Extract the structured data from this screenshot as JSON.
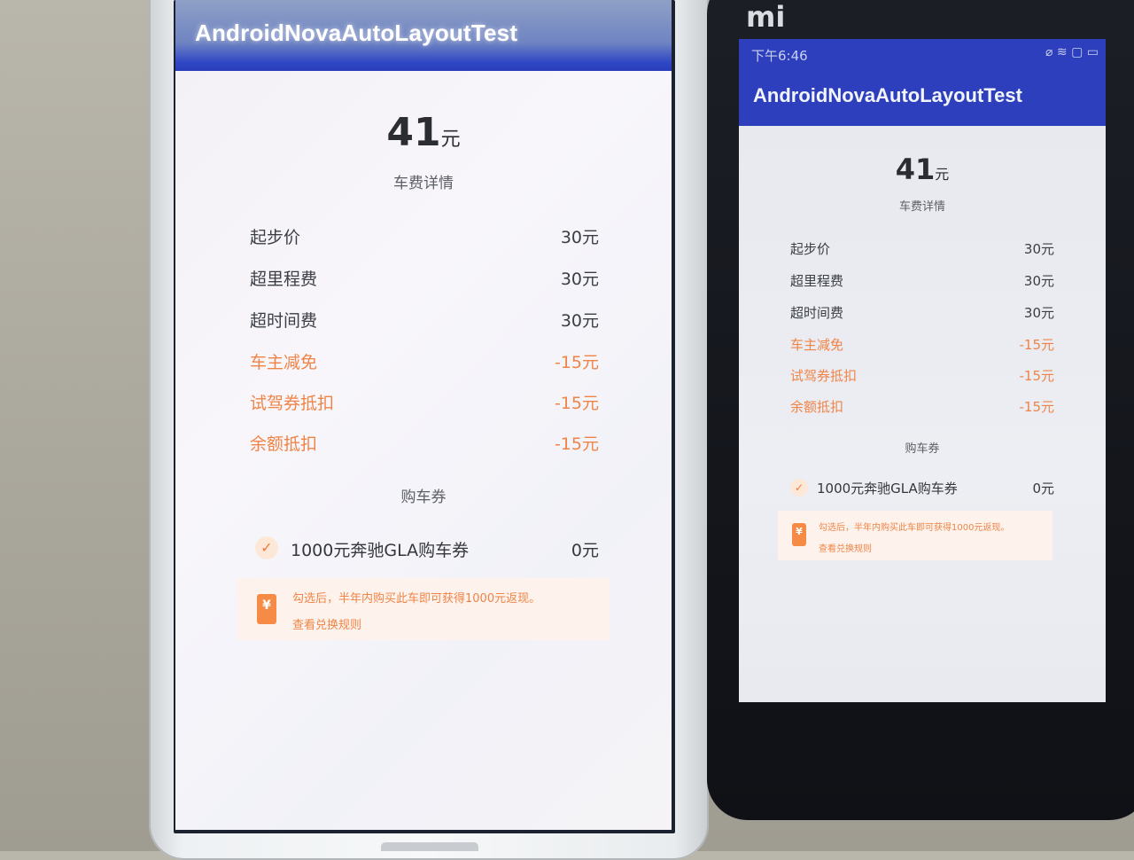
{
  "left_phone": {
    "app_title": "AndroidNovaAutoLayoutTest",
    "total_amount": "41",
    "total_unit": "元",
    "detail_title": "车费详情",
    "items": [
      {
        "label": "起步价",
        "value": "30元"
      },
      {
        "label": "超里程费",
        "value": "30元"
      },
      {
        "label": "超时间费",
        "value": "30元"
      },
      {
        "label": "车主减免",
        "value": "-15元"
      },
      {
        "label": "试驾券抵扣",
        "value": "-15元"
      },
      {
        "label": "余额抵扣",
        "value": "-15元"
      }
    ],
    "coupon_section_title": "购车券",
    "coupon": {
      "label": "1000元奔驰GLA购车券",
      "value": "0元",
      "check_icon": "check-icon"
    },
    "notice": {
      "icon": "ticket-yen-icon",
      "text": "勾选后，半年内购买此车即可获得1000元返现。",
      "link": "查看兑换规则"
    }
  },
  "right_phone": {
    "brand": "mi",
    "status_time": "下午6:46",
    "status_icons": "⌀ ≋ ▢ ▭",
    "app_title": "AndroidNovaAutoLayoutTest",
    "total_amount": "41",
    "total_unit": "元",
    "detail_title": "车费详情",
    "items": [
      {
        "label": "起步价",
        "value": "30元"
      },
      {
        "label": "超里程费",
        "value": "30元"
      },
      {
        "label": "超时间费",
        "value": "30元"
      },
      {
        "label": "车主减免",
        "value": "-15元"
      },
      {
        "label": "试驾券抵扣",
        "value": "-15元"
      },
      {
        "label": "余额抵扣",
        "value": "-15元"
      }
    ],
    "coupon_section_title": "购车券",
    "coupon": {
      "label": "1000元奔驰GLA购车券",
      "value": "0元",
      "check_icon": "check-icon"
    },
    "notice": {
      "icon": "ticket-yen-icon",
      "text": "勾选后，半年内购买此车即可获得1000元返现。",
      "link": "查看兑换规则"
    }
  },
  "colors": {
    "app_bar": "#2d3fbc",
    "discount_text": "#f08447",
    "normal_text": "#3b3e45",
    "notice_bg": "#fdf3ec"
  }
}
